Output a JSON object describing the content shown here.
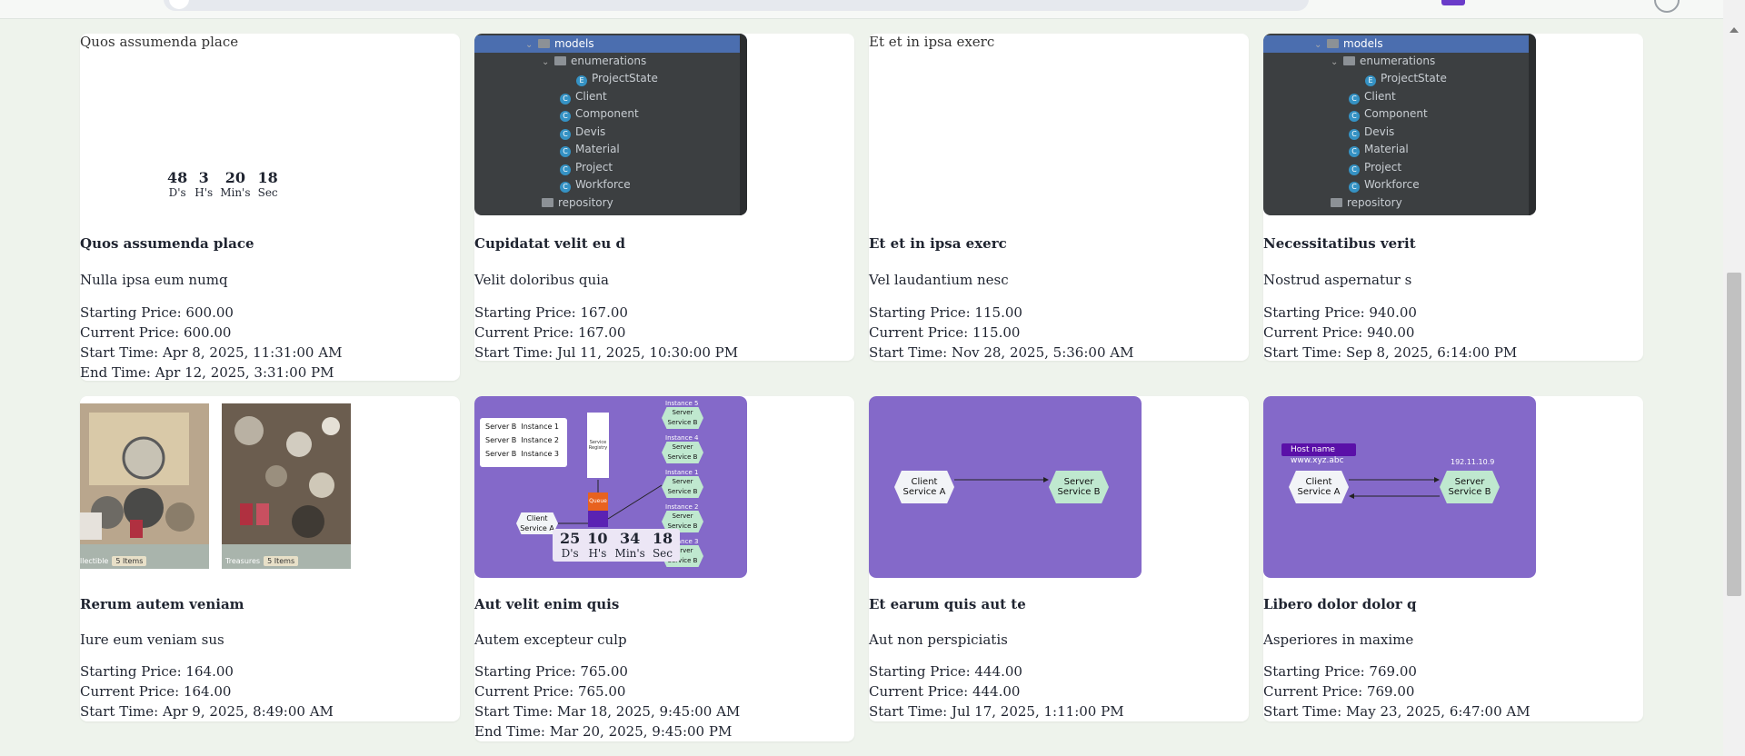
{
  "header": {
    "search_placeholder": ""
  },
  "countdown_labels": {
    "days": "D's",
    "hours": "H's",
    "minutes": "Min's",
    "seconds": "Sec"
  },
  "tree": {
    "models": "models",
    "enumerations": "enumerations",
    "project_state": "ProjectState",
    "items": [
      "Client",
      "Component",
      "Devis",
      "Material",
      "Project",
      "Workforce"
    ],
    "repository": "repository"
  },
  "diagram": {
    "client": "Client Service A",
    "server": "Server Service B",
    "host_name": "Host name",
    "host_url": "www.xyz.abc",
    "ip": "192.11.10.9",
    "instances": [
      "Instance 5",
      "Instance 4",
      "Instance 1",
      "Instance 2",
      "Instance 3"
    ],
    "table": [
      [
        "Server B",
        "Instance 1"
      ],
      [
        "Server B",
        "Instance 2"
      ],
      [
        "Server B",
        "Instance 3"
      ]
    ],
    "service_registry": "Service Registry",
    "queue_label": "Queue"
  },
  "collage": {
    "left_caption": "llectible",
    "right_caption": "Treasures",
    "items_badge": "5 Items"
  },
  "auctions": [
    {
      "alt": "Quos assumenda place",
      "title": "Quos assumenda place",
      "desc": "Nulla ipsa eum numq",
      "starting": "Starting Price: 600.00",
      "current": "Current Price: 600.00",
      "start": "Start Time: Apr 8, 2025, 11:31:00 AM",
      "end": "End Time: Apr 12, 2025, 3:31:00 PM",
      "countdown": {
        "d": "48",
        "h": "3",
        "m": "20",
        "s": "18"
      }
    },
    {
      "title": "Cupidatat velit eu d",
      "desc": "Velit doloribus quia",
      "starting": "Starting Price: 167.00",
      "current": "Current Price: 167.00",
      "start": "Start Time: Jul 11, 2025, 10:30:00 PM"
    },
    {
      "alt": "Et et in ipsa exerc",
      "title": "Et et in ipsa exerc",
      "desc": "Vel laudantium nesc",
      "starting": "Starting Price: 115.00",
      "current": "Current Price: 115.00",
      "start": "Start Time: Nov 28, 2025, 5:36:00 AM"
    },
    {
      "title": "Necessitatibus verit",
      "desc": "Nostrud aspernatur s",
      "starting": "Starting Price: 940.00",
      "current": "Current Price: 940.00",
      "start": "Start Time: Sep 8, 2025, 6:14:00 PM"
    },
    {
      "title": "Rerum autem veniam",
      "desc": "Iure eum veniam sus",
      "starting": "Starting Price: 164.00",
      "current": "Current Price: 164.00",
      "start": "Start Time: Apr 9, 2025, 8:49:00 AM"
    },
    {
      "title": "Aut velit enim quis",
      "desc": "Autem excepteur culp",
      "starting": "Starting Price: 765.00",
      "current": "Current Price: 765.00",
      "start": "Start Time: Mar 18, 2025, 9:45:00 AM",
      "end": "End Time: Mar 20, 2025, 9:45:00 PM",
      "countdown": {
        "d": "25",
        "h": "10",
        "m": "34",
        "s": "18"
      }
    },
    {
      "title": "Et earum quis aut te",
      "desc": "Aut non perspiciatis",
      "starting": "Starting Price: 444.00",
      "current": "Current Price: 444.00",
      "start": "Start Time: Jul 17, 2025, 1:11:00 PM"
    },
    {
      "title": "Libero dolor dolor q",
      "desc": "Asperiores in maxime",
      "starting": "Starting Price: 769.00",
      "current": "Current Price: 769.00",
      "start": "Start Time: May 23, 2025, 6:47:00 AM"
    }
  ]
}
